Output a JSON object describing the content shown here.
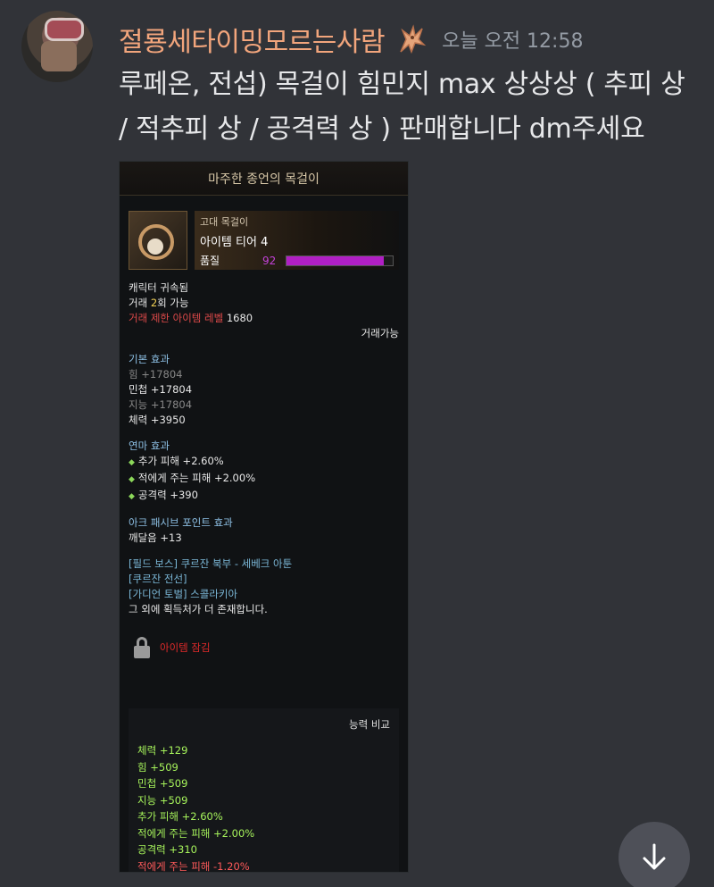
{
  "author": {
    "username": "절룡세타이밍모르는사람",
    "timestamp": "오늘 오전 12:58"
  },
  "message": {
    "text": "루페온, 전섭) 목걸이 힘민지 max 상상상 ( 추피 상 / 적추피 상 / 공격력 상 ) 판매합니다 dm주세요"
  },
  "tooltip": {
    "title": "마주한 종언의 목걸이",
    "item_type": "고대 목걸이",
    "tier": "아이템 티어 4",
    "quality_label": "품질",
    "quality_value": "92",
    "quality_fraction": 0.92,
    "bound": "캐릭터 귀속됨",
    "trade_prefix": "거래 ",
    "trade_count": "2",
    "trade_suffix": "회 가능",
    "trade_limit_label": "거래 제한 아이템 레벨",
    "trade_limit_value": " 1680",
    "tradeable": "거래가능",
    "base_title": "기본 효과",
    "base_stats": [
      "힘 +17804",
      "민첩 +17804",
      "지능 +17804",
      "체력 +3950"
    ],
    "enchant_title": "연마 효과",
    "enchant_stats": [
      "추가 피해 +2.60%",
      "적에게 주는 피해 +2.00%",
      "공격력 +390"
    ],
    "ark_title": "아크 패시브 포인트 효과",
    "ark_value": "깨달음 +13",
    "sources": [
      "[필드 보스] 쿠르잔 북부 - 세베크 아툰",
      "[쿠르잔 전선]",
      "[가디언 토벌] 스콜라키아",
      "그 외에 획득처가 더 존재합니다."
    ],
    "locked": "아이템 잠김",
    "compare_title": "능력 비교",
    "compare_stats": [
      "체력 +129",
      "힘 +509",
      "민첩 +509",
      "지능 +509",
      "추가 피해 +2.60%",
      "적에게 주는 피해 +2.00%",
      "공격력 +310",
      "적에게 주는 피해 -1.20%"
    ]
  },
  "colors": {
    "background": "#313338",
    "username": "#f2a57c",
    "quality": "#c342d8"
  },
  "icons": {
    "role": "dragon-role-icon",
    "scroll": "arrow-down-icon",
    "lock": "lock-icon"
  }
}
